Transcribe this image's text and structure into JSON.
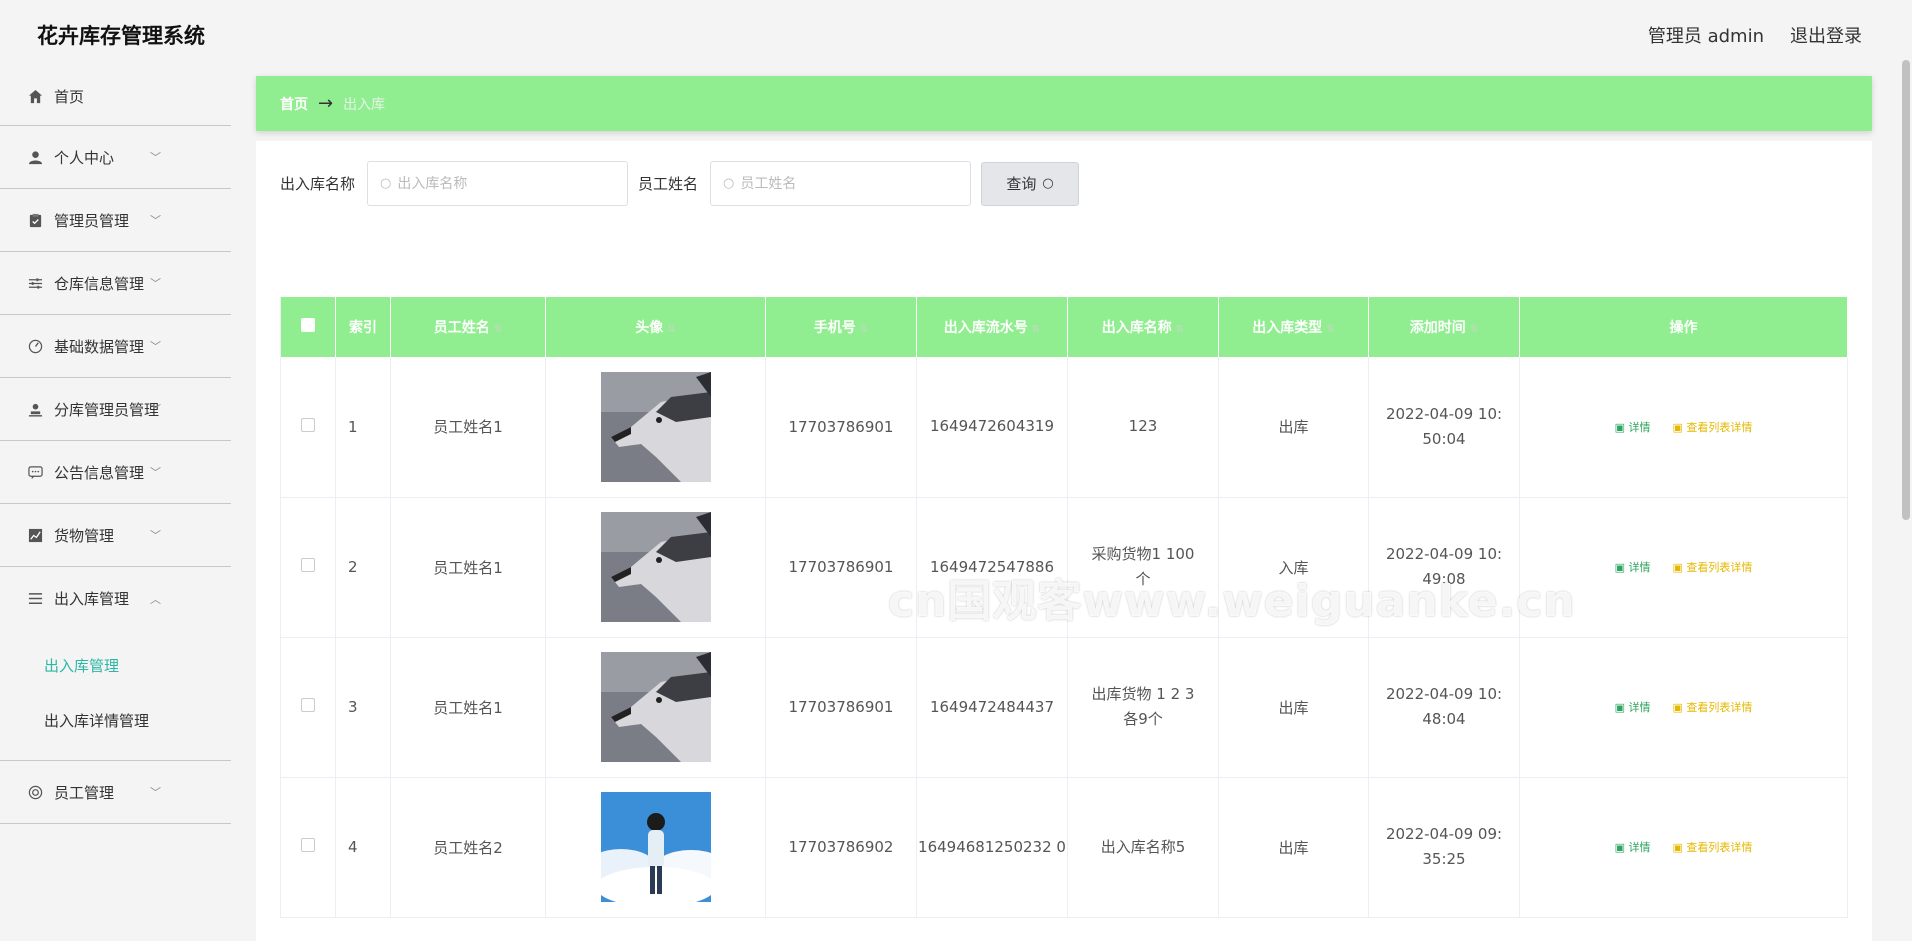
{
  "app": {
    "title": "花卉库存管理系统"
  },
  "header": {
    "user_label": "管理员 admin",
    "logout_label": "退出登录"
  },
  "sidebar": {
    "items": [
      {
        "label": "首页",
        "icon": "home-icon"
      },
      {
        "label": "个人中心",
        "icon": "user-icon"
      },
      {
        "label": "管理员管理",
        "icon": "clipboard-icon"
      },
      {
        "label": "仓库信息管理",
        "icon": "sliders-icon"
      },
      {
        "label": "基础数据管理",
        "icon": "gauge-icon"
      },
      {
        "label": "分库管理员管理",
        "icon": "user-stamp-icon"
      },
      {
        "label": "公告信息管理",
        "icon": "chat-icon"
      },
      {
        "label": "货物管理",
        "icon": "chart-icon"
      },
      {
        "label": "出入库管理",
        "icon": "list-icon"
      },
      {
        "label": "员工管理",
        "icon": "lifebuoy-icon"
      }
    ],
    "submenu": [
      {
        "label": "出入库管理",
        "active": true
      },
      {
        "label": "出入库详情管理",
        "active": false
      }
    ]
  },
  "breadcrumb": {
    "home": "首页",
    "arrow": "→",
    "current": "出入库"
  },
  "search": {
    "name_label": "出入库名称",
    "name_placeholder": "出入库名称",
    "staff_label": "员工姓名",
    "staff_placeholder": "员工姓名",
    "query_label": "查询"
  },
  "table": {
    "headers": [
      "索引",
      "员工姓名",
      "头像",
      "手机号",
      "出入库流水号",
      "出入库名称",
      "出入库类型",
      "添加时间",
      "操作"
    ],
    "rows": [
      {
        "index": "1",
        "name": "员工姓名1",
        "avatar": "husky",
        "phone": "17703786901",
        "serial": "1649472604319",
        "title": "123",
        "type": "出库",
        "time": "2022-04-09 10:50:04"
      },
      {
        "index": "2",
        "name": "员工姓名1",
        "avatar": "husky",
        "phone": "17703786901",
        "serial": "1649472547886",
        "title": "采购货物1 100个",
        "type": "入库",
        "time": "2022-04-09 10:49:08"
      },
      {
        "index": "3",
        "name": "员工姓名1",
        "avatar": "husky",
        "phone": "17703786901",
        "serial": "1649472484437",
        "title": "出库货物 1 2 3各9个",
        "type": "出库",
        "time": "2022-04-09 10:48:04"
      },
      {
        "index": "4",
        "name": "员工姓名2",
        "avatar": "sky-boy",
        "phone": "17703786902",
        "serial": "16494681250232 0",
        "title": "出入库名称5",
        "type": "出库",
        "time": "2022-04-09 09:35:25"
      }
    ],
    "op_detail": "详情",
    "op_list": "查看列表详情"
  },
  "watermark": "cn国观客www.weiguanke.cn",
  "colors": {
    "accent": "#90ee90",
    "active_menu": "#2db7a3",
    "detail": "#2ca55e",
    "list": "#e6b800"
  }
}
